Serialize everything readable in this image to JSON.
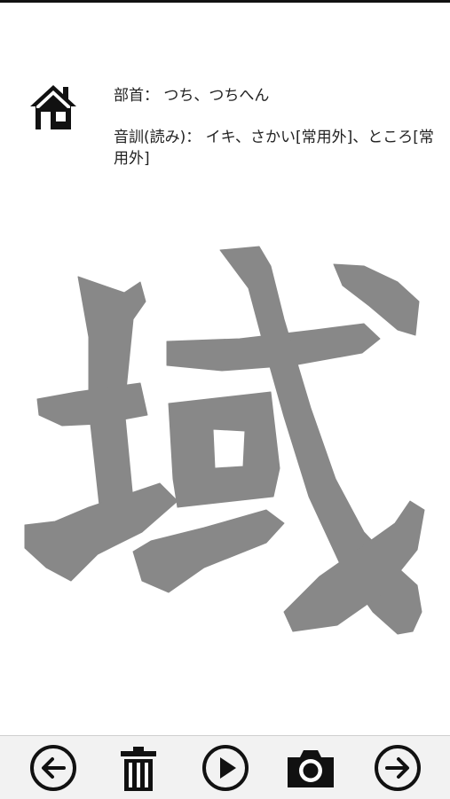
{
  "header": {
    "home_icon": "home-icon"
  },
  "kanji_info": {
    "radical_label": "部首：",
    "radical_value": "つち、つちへん",
    "reading_label": "音訓(読み)：",
    "reading_value": "イキ、さかい[常用外]、ところ[常用外]"
  },
  "kanji": {
    "character": "域",
    "color": "#888888"
  },
  "toolbar": {
    "buttons": [
      {
        "icon": "arrow-left-circle-icon"
      },
      {
        "icon": "trash-icon"
      },
      {
        "icon": "play-circle-icon"
      },
      {
        "icon": "camera-icon"
      },
      {
        "icon": "arrow-right-circle-icon"
      }
    ]
  }
}
